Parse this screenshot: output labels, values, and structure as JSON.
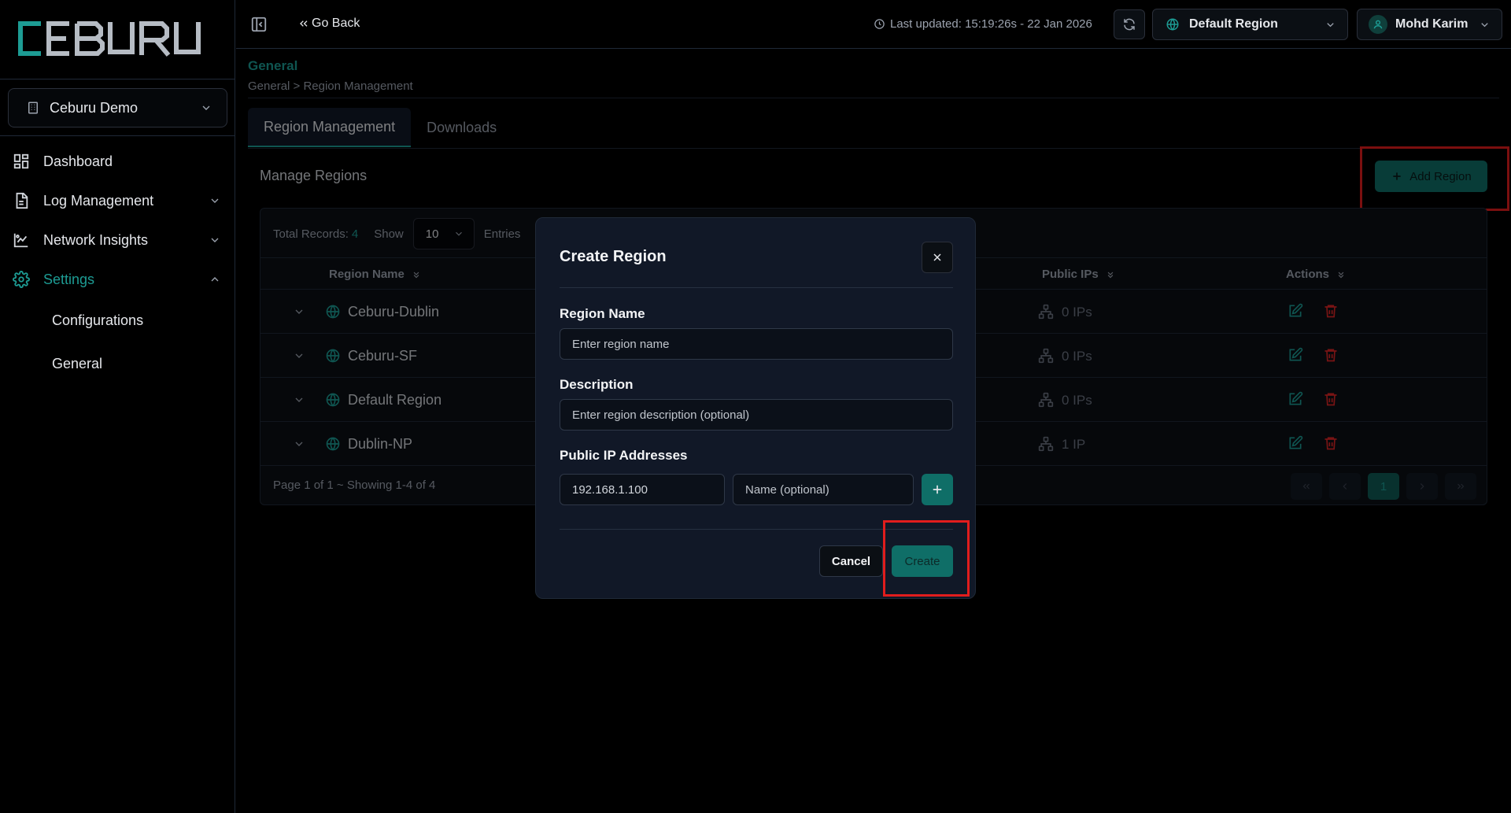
{
  "brand": {
    "logo_text": "CEBURU",
    "accent": "#1d9c94",
    "danger": "#dc2626",
    "highlight": "#e11d1d"
  },
  "sidebar": {
    "org": "Ceburu Demo",
    "items": [
      {
        "label": "Dashboard",
        "icon": "dashboard-icon"
      },
      {
        "label": "Log Management",
        "icon": "document-icon"
      },
      {
        "label": "Network Insights",
        "icon": "chart-icon"
      },
      {
        "label": "Settings",
        "icon": "gear-icon"
      }
    ],
    "settings_children": [
      "Configurations",
      "General"
    ]
  },
  "header": {
    "go_back": "Go Back",
    "last_updated": "Last updated: 15:19:26s - 22 Jan 2026",
    "region": "Default Region",
    "user": "Mohd Karim"
  },
  "page": {
    "title": "General",
    "breadcrumb": "General > Region Management",
    "tabs": [
      "Region Management",
      "Downloads"
    ],
    "section_title": "Manage Regions",
    "add_button": "Add Region"
  },
  "table": {
    "total_label": "Total Records:",
    "total": "4",
    "show_label": "Show",
    "page_size": "10",
    "entries_label": "Entries",
    "columns": {
      "name": "Region Name",
      "ips": "Public IPs",
      "actions": "Actions"
    },
    "rows": [
      {
        "name": "Ceburu-Dublin",
        "ips": "0 IPs"
      },
      {
        "name": "Ceburu-SF",
        "ips": "0 IPs"
      },
      {
        "name": "Default Region",
        "ips": "0 IPs"
      },
      {
        "name": "Dublin-NP",
        "ips": "1 IP"
      }
    ],
    "footer": "Page 1 of 1 ~ Showing 1-4 of 4",
    "current_page": "1"
  },
  "modal": {
    "title": "Create Region",
    "name_label": "Region Name",
    "name_placeholder": "Enter region name",
    "desc_label": "Description",
    "desc_placeholder": "Enter region description (optional)",
    "ip_label": "Public IP Addresses",
    "ip_value": "192.168.1.100",
    "ip_name_placeholder": "Name (optional)",
    "cancel": "Cancel",
    "create": "Create"
  }
}
